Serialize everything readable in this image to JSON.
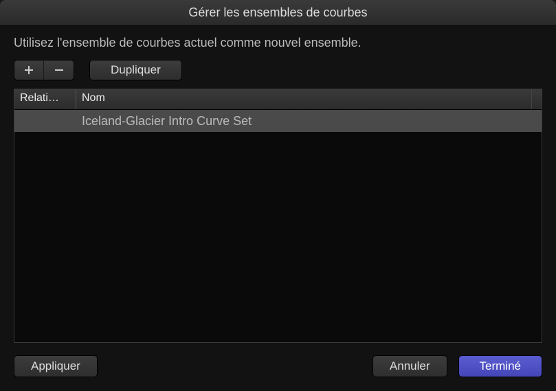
{
  "window": {
    "title": "Gérer les ensembles de courbes"
  },
  "description": "Utilisez l'ensemble de courbes actuel comme nouvel ensemble.",
  "toolbar": {
    "add_icon": "plus",
    "remove_icon": "minus",
    "duplicate_label": "Dupliquer"
  },
  "table": {
    "columns": {
      "relative": "Relati…",
      "name": "Nom"
    },
    "rows": [
      {
        "relative": "",
        "name": "Iceland-Glacier Intro Curve Set",
        "selected": true
      }
    ]
  },
  "footer": {
    "apply_label": "Appliquer",
    "cancel_label": "Annuler",
    "done_label": "Terminé"
  }
}
